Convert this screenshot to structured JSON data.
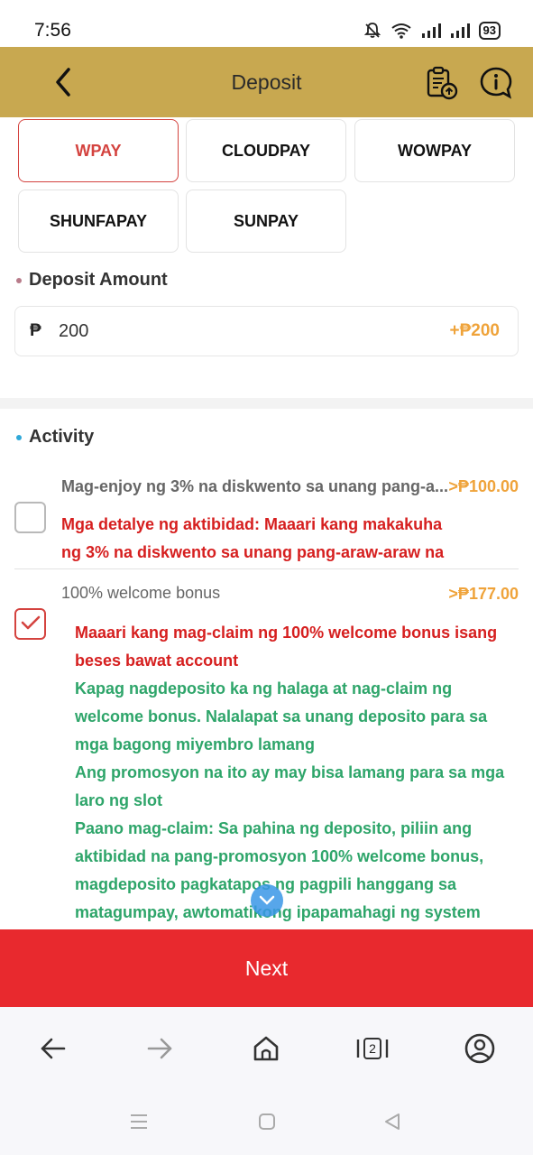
{
  "status_bar": {
    "time": "7:56",
    "battery": "93"
  },
  "header": {
    "title": "Deposit"
  },
  "payment_methods": [
    {
      "label": "WPAY",
      "selected": true
    },
    {
      "label": "CLOUDPAY",
      "selected": false
    },
    {
      "label": "WOWPAY",
      "selected": false
    },
    {
      "label": "SHUNFAPAY",
      "selected": false
    },
    {
      "label": "SUNPAY",
      "selected": false
    }
  ],
  "deposit": {
    "label": "Deposit Amount",
    "currency_symbol": "₱",
    "amount_value": "200",
    "bonus": "+₱200"
  },
  "activity": {
    "label": "Activity",
    "items": [
      {
        "title": "Mag-enjoy ng 3% na diskwento sa unang pang-a...",
        "amount": ">₱100.00",
        "checked": false,
        "details": "Mga detalye ng aktibidad: Maaari kang makakuha ng 3% na diskwento sa unang pang-araw-araw na"
      },
      {
        "title": "100% welcome bonus",
        "amount": ">₱177.00",
        "checked": true,
        "red_text": "Maaari kang mag-claim ng 100% welcome bonus isang beses bawat account",
        "green_lines": [
          "Kapag nagdeposito ka ng halaga at nag-claim ng welcome bonus. Nalalapat sa unang deposito para sa mga bagong miyembro lamang",
          "Ang promosyon na ito ay may bisa lamang para sa mga laro ng slot",
          "Paano mag-claim: Sa pahina ng deposito, piliin ang aktibidad na pang-promosyon 100% welcome bonus, magdeposito pagkatapos ng pagpili hanggang sa matagumpay, awtomatikong ipapamahagi ng system"
        ]
      }
    ]
  },
  "next_button": {
    "label": "Next"
  },
  "browser_nav": {
    "tab_count": "2"
  },
  "colors": {
    "header_bg": "#c8a850",
    "accent_red": "#e8292e",
    "bonus_orange": "#efa33a",
    "detail_green": "#2ea56a"
  }
}
